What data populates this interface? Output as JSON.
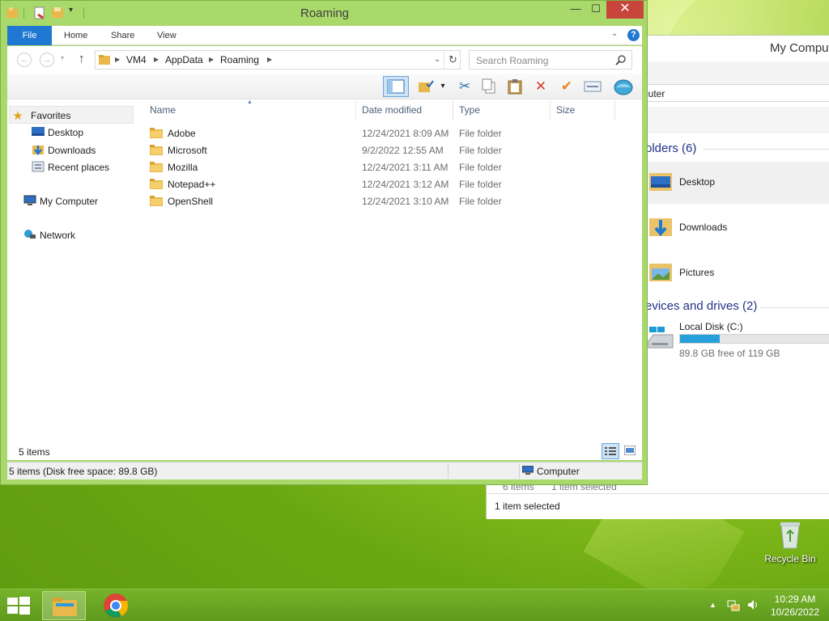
{
  "background_window": {
    "title": "My Comput",
    "address": "puter",
    "folders_group": "olders (6)",
    "folders": [
      "Desktop",
      "Downloads",
      "Pictures"
    ],
    "devices_group": "evices and drives (2)",
    "drive": {
      "label": "Local Disk (C:)",
      "free_text": "89.8 GB free of 119 GB",
      "used_fraction": 0.245
    },
    "status_items": "6 items",
    "status_selected": "1 item selected",
    "status_bottom": "1 item selected"
  },
  "window": {
    "title": "Roaming",
    "controls": {
      "minimize": "—",
      "maximize": "☐",
      "close": "✕"
    }
  },
  "ribbon": {
    "tabs": [
      "File",
      "Home",
      "Share",
      "View"
    ]
  },
  "address": {
    "crumbs": [
      "VM4",
      "AppData",
      "Roaming"
    ],
    "search_placeholder": "Search Roaming"
  },
  "nav_pane": {
    "favorites": "Favorites",
    "items": [
      "Desktop",
      "Downloads",
      "Recent places"
    ],
    "my_computer": "My Computer",
    "network": "Network"
  },
  "columns": {
    "name": "Name",
    "date": "Date modified",
    "type": "Type",
    "size": "Size"
  },
  "files": [
    {
      "name": "Adobe",
      "date": "12/24/2021 8:09 AM",
      "type": "File folder",
      "size": ""
    },
    {
      "name": "Microsoft",
      "date": "9/2/2022 12:55 AM",
      "type": "File folder",
      "size": ""
    },
    {
      "name": "Mozilla",
      "date": "12/24/2021 3:11 AM",
      "type": "File folder",
      "size": ""
    },
    {
      "name": "Notepad++",
      "date": "12/24/2021 3:12 AM",
      "type": "File folder",
      "size": ""
    },
    {
      "name": "OpenShell",
      "date": "12/24/2021 3:10 AM",
      "type": "File folder",
      "size": ""
    }
  ],
  "item_count": "5 items",
  "statusbar": {
    "left": "5 items (Disk free space: 89.8 GB)",
    "right": "Computer"
  },
  "desktop": {
    "recycle_bin": "Recycle Bin"
  },
  "taskbar": {
    "time": "10:29 AM",
    "date": "10/26/2022",
    "apps": [
      "file-explorer",
      "chrome"
    ]
  },
  "colors": {
    "accent": "#1f78d1",
    "window_frame": "#a9d86b",
    "close_button": "#c7453a",
    "taskbar": "#6aa822",
    "folder": "#e9b84a",
    "drive_bar": "#26a0da"
  }
}
